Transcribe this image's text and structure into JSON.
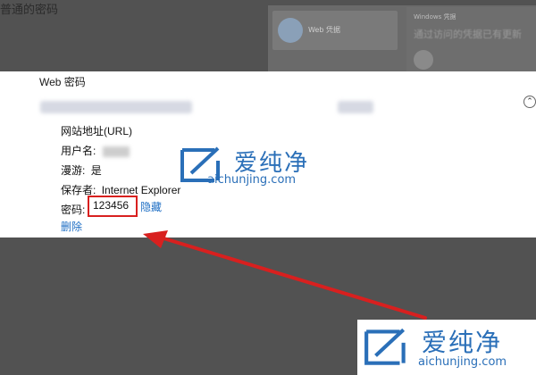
{
  "background": {
    "page_title": "普通的密码",
    "card_left_label": "Web 凭据",
    "card_right_header": "Windows 凭据",
    "card_right_text": "通过访问的凭据已有更新"
  },
  "dialog": {
    "title": "Web 密码",
    "collapse_icon": "chevron-up-icon",
    "fields": [
      {
        "label": "网站地址(URL)",
        "value": ""
      },
      {
        "label": "用户名:",
        "value": ""
      },
      {
        "label": "漫游:",
        "value": "是"
      },
      {
        "label": "保存者:",
        "value": "Internet Explorer"
      },
      {
        "label": "密码:",
        "value": "123456"
      }
    ],
    "hide_label": "隐藏",
    "delete_label": "删除"
  },
  "watermark": {
    "zh": "爱纯净",
    "en": "aichunjing.com"
  },
  "colors": {
    "highlight": "#d8201f",
    "link": "#1f6fc4",
    "brand": "#2a6fb8"
  }
}
